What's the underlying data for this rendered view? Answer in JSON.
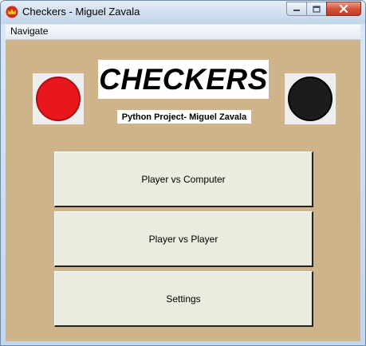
{
  "window": {
    "title": "Checkers - Miguel Zavala",
    "app_icon": "crown-icon",
    "controls": [
      "minimize-icon",
      "maximize-icon",
      "close-icon"
    ]
  },
  "menu": {
    "items": [
      "Navigate"
    ]
  },
  "main": {
    "logo_text": "CHECKERS",
    "subtitle": "Python Project- Miguel Zavala",
    "pieces": [
      {
        "name": "red-checker-piece",
        "color": "#e8171c"
      },
      {
        "name": "black-checker-piece",
        "color": "#1c1c1c"
      }
    ],
    "buttons": [
      {
        "label": "Player vs Computer"
      },
      {
        "label": "Player vs Player"
      },
      {
        "label": "Settings"
      }
    ]
  },
  "colors": {
    "background": "#cfb48b",
    "button_face": "#ecebdf",
    "close_button": "#c94b32"
  }
}
